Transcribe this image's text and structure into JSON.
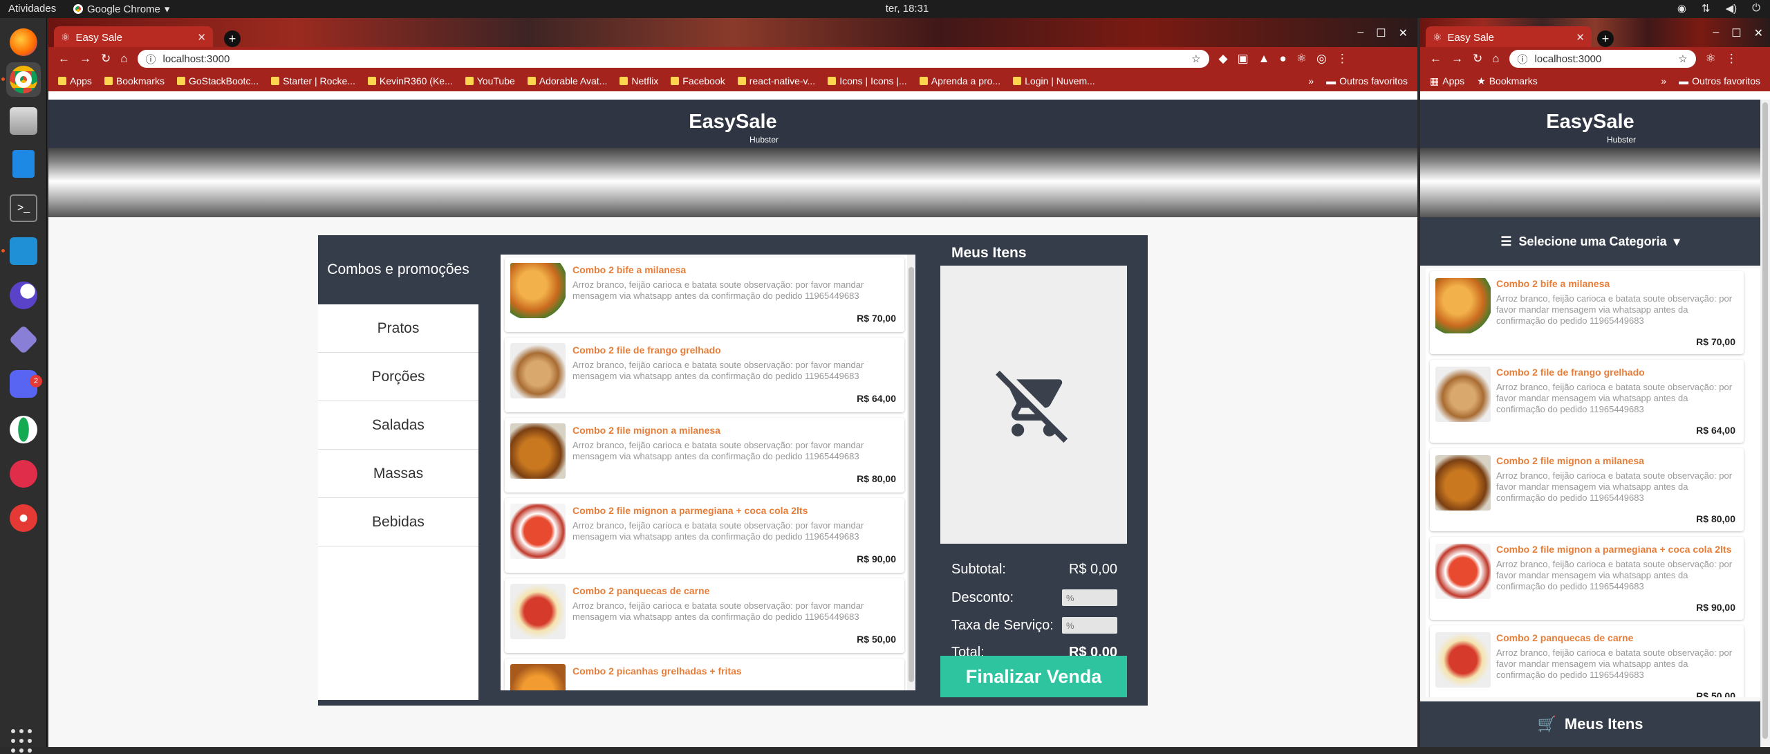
{
  "system": {
    "activities": "Atividades",
    "app_name": "Google Chrome",
    "clock": "ter, 18:31",
    "dock_badge": "2"
  },
  "browser": {
    "tab_title": "Easy Sale",
    "url": "localhost:3000",
    "bookmarks": [
      "Apps",
      "Bookmarks",
      "GoStackBootc...",
      "Starter | Rocke...",
      "KevinR360 (Ke...",
      "YouTube",
      "Adorable Avat...",
      "Netflix",
      "Facebook",
      "react-native-v...",
      "Icons | Icons |...",
      "Aprenda a pro...",
      "Login | Nuvem..."
    ],
    "bookmarks_short": [
      "Apps",
      "Bookmarks"
    ],
    "more": "»",
    "other_favorites": "Outros favoritos"
  },
  "page": {
    "brand": "EasySale",
    "subtitle": "Hubster",
    "categories_title": "Combos e promoções",
    "categories": [
      "Pratos",
      "Porções",
      "Saladas",
      "Massas",
      "Bebidas"
    ],
    "select_category": "Selecione uma Categoria",
    "products": [
      {
        "name": "Combo 2 bife a milanesa",
        "description": "Arroz branco, feijão carioca e batata soute observação: por favor mandar mensagem via whatsapp antes da confirmação do pedido 11965449683",
        "price": "R$ 70,00",
        "image": "food1"
      },
      {
        "name": "Combo 2 file de frango grelhado",
        "description": "Arroz branco, feijão carioca e batata soute observação: por favor mandar mensagem via whatsapp antes da confirmação do pedido 11965449683",
        "price": "R$ 64,00",
        "image": "food2"
      },
      {
        "name": "Combo 2 file mignon a milanesa",
        "description": "Arroz branco, feijão carioca e batata soute observação: por favor mandar mensagem via whatsapp antes da confirmação do pedido 11965449683",
        "price": "R$ 80,00",
        "image": "food3"
      },
      {
        "name": "Combo 2 file mignon a parmegiana + coca cola 2lts",
        "description": "Arroz branco, feijão carioca e batata soute observação: por favor mandar mensagem via whatsapp antes da confirmação do pedido 11965449683",
        "price": "R$ 90,00",
        "image": "food4"
      },
      {
        "name": "Combo 2 panquecas de carne",
        "description": "Arroz branco, feijão carioca e batata soute observação: por favor mandar mensagem via whatsapp antes da confirmação do pedido 11965449683",
        "price": "R$ 50,00",
        "image": "food5"
      },
      {
        "name": "Combo 2 picanhas grelhadas + fritas",
        "description": "",
        "price": "",
        "image": "food6"
      }
    ],
    "cart": {
      "title": "Meus Itens",
      "subtotal_label": "Subtotal:",
      "subtotal_value": "R$ 0,00",
      "discount_label": "Desconto:",
      "discount_placeholder": "%",
      "service_label": "Taxa de Serviço:",
      "service_placeholder": "%",
      "total_label": "Total:",
      "total_value": "R$ 0,00",
      "checkout": "Finalizar Venda",
      "empty_icon": "remove-shopping-cart-icon"
    }
  }
}
